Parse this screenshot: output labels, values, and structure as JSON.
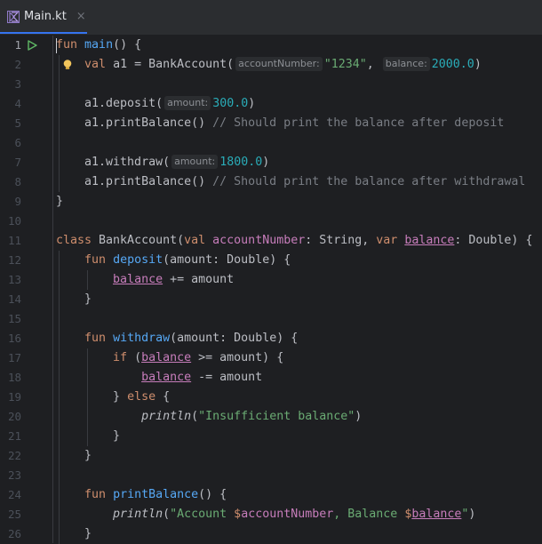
{
  "tab": {
    "filename": "Main.kt",
    "close_glyph": "×",
    "icon": "kotlin-file-icon"
  },
  "colors": {
    "keyword": "#cf8e6d",
    "function": "#56a8f5",
    "property": "#c77dbb",
    "string": "#6aab73",
    "number": "#2aacb8",
    "comment": "#7a7e85",
    "text": "#bcbec4"
  },
  "editor": {
    "line_numbers": [
      "1",
      "2",
      "3",
      "4",
      "5",
      "6",
      "7",
      "8",
      "9",
      "10",
      "11",
      "12",
      "13",
      "14",
      "15",
      "16",
      "17",
      "18",
      "19",
      "20",
      "21",
      "22",
      "23",
      "24",
      "25",
      "26"
    ],
    "lines": [
      [
        {
          "t": "fun",
          "c": "kw"
        },
        {
          "t": " "
        },
        {
          "t": "main",
          "c": "fn"
        },
        {
          "t": "() {"
        }
      ],
      [
        {
          "t": "    "
        },
        {
          "t": "val",
          "c": "kw"
        },
        {
          "t": " a1 = BankAccount("
        },
        {
          "t": "accountNumber:",
          "c": "hint"
        },
        {
          "t": "\"1234\"",
          "c": "str"
        },
        {
          "t": ", "
        },
        {
          "t": "balance:",
          "c": "hint"
        },
        {
          "t": "2000.0",
          "c": "num"
        },
        {
          "t": ")"
        }
      ],
      [],
      [
        {
          "t": "    a1.deposit("
        },
        {
          "t": "amount:",
          "c": "hint"
        },
        {
          "t": "300.0",
          "c": "num"
        },
        {
          "t": ")"
        }
      ],
      [
        {
          "t": "    a1.printBalance() "
        },
        {
          "t": "// Should print the balance after deposit",
          "c": "cmt"
        }
      ],
      [],
      [
        {
          "t": "    a1.withdraw("
        },
        {
          "t": "amount:",
          "c": "hint"
        },
        {
          "t": "1800.0",
          "c": "num"
        },
        {
          "t": ")"
        }
      ],
      [
        {
          "t": "    a1.printBalance() "
        },
        {
          "t": "// Should print the balance after withdrawal",
          "c": "cmt"
        }
      ],
      [
        {
          "t": "}"
        }
      ],
      [],
      [
        {
          "t": "class",
          "c": "kw"
        },
        {
          "t": " BankAccount("
        },
        {
          "t": "val",
          "c": "kw"
        },
        {
          "t": " "
        },
        {
          "t": "accountNumber",
          "c": "prop"
        },
        {
          "t": ": String, "
        },
        {
          "t": "var",
          "c": "kw"
        },
        {
          "t": " "
        },
        {
          "t": "balance",
          "c": "prop ul"
        },
        {
          "t": ": Double) {"
        }
      ],
      [
        {
          "t": "    "
        },
        {
          "t": "fun",
          "c": "kw"
        },
        {
          "t": " "
        },
        {
          "t": "deposit",
          "c": "fn"
        },
        {
          "t": "(amount: Double) {"
        }
      ],
      [
        {
          "t": "        "
        },
        {
          "t": "balance",
          "c": "prop ul"
        },
        {
          "t": " += amount"
        }
      ],
      [
        {
          "t": "    }"
        }
      ],
      [],
      [
        {
          "t": "    "
        },
        {
          "t": "fun",
          "c": "kw"
        },
        {
          "t": " "
        },
        {
          "t": "withdraw",
          "c": "fn"
        },
        {
          "t": "(amount: Double) {"
        }
      ],
      [
        {
          "t": "        "
        },
        {
          "t": "if",
          "c": "kw"
        },
        {
          "t": " ("
        },
        {
          "t": "balance",
          "c": "prop ul"
        },
        {
          "t": " >= amount) {"
        }
      ],
      [
        {
          "t": "            "
        },
        {
          "t": "balance",
          "c": "prop ul"
        },
        {
          "t": " -= amount"
        }
      ],
      [
        {
          "t": "        } "
        },
        {
          "t": "else",
          "c": "kw"
        },
        {
          "t": " {"
        }
      ],
      [
        {
          "t": "            "
        },
        {
          "t": "println",
          "c": "itl"
        },
        {
          "t": "("
        },
        {
          "t": "\"Insufficient balance\"",
          "c": "str"
        },
        {
          "t": ")"
        }
      ],
      [
        {
          "t": "        }"
        }
      ],
      [
        {
          "t": "    }"
        }
      ],
      [],
      [
        {
          "t": "    "
        },
        {
          "t": "fun",
          "c": "kw"
        },
        {
          "t": " "
        },
        {
          "t": "printBalance",
          "c": "fn"
        },
        {
          "t": "() {"
        }
      ],
      [
        {
          "t": "        "
        },
        {
          "t": "println",
          "c": "itl"
        },
        {
          "t": "("
        },
        {
          "t": "\"Account ",
          "c": "str"
        },
        {
          "t": "$",
          "c": "kw"
        },
        {
          "t": "accountNumber",
          "c": "prop"
        },
        {
          "t": ", Balance ",
          "c": "str"
        },
        {
          "t": "$",
          "c": "kw"
        },
        {
          "t": "balance",
          "c": "prop ul"
        },
        {
          "t": "\"",
          "c": "str"
        },
        {
          "t": ")"
        }
      ],
      [
        {
          "t": "    }"
        }
      ]
    ]
  }
}
